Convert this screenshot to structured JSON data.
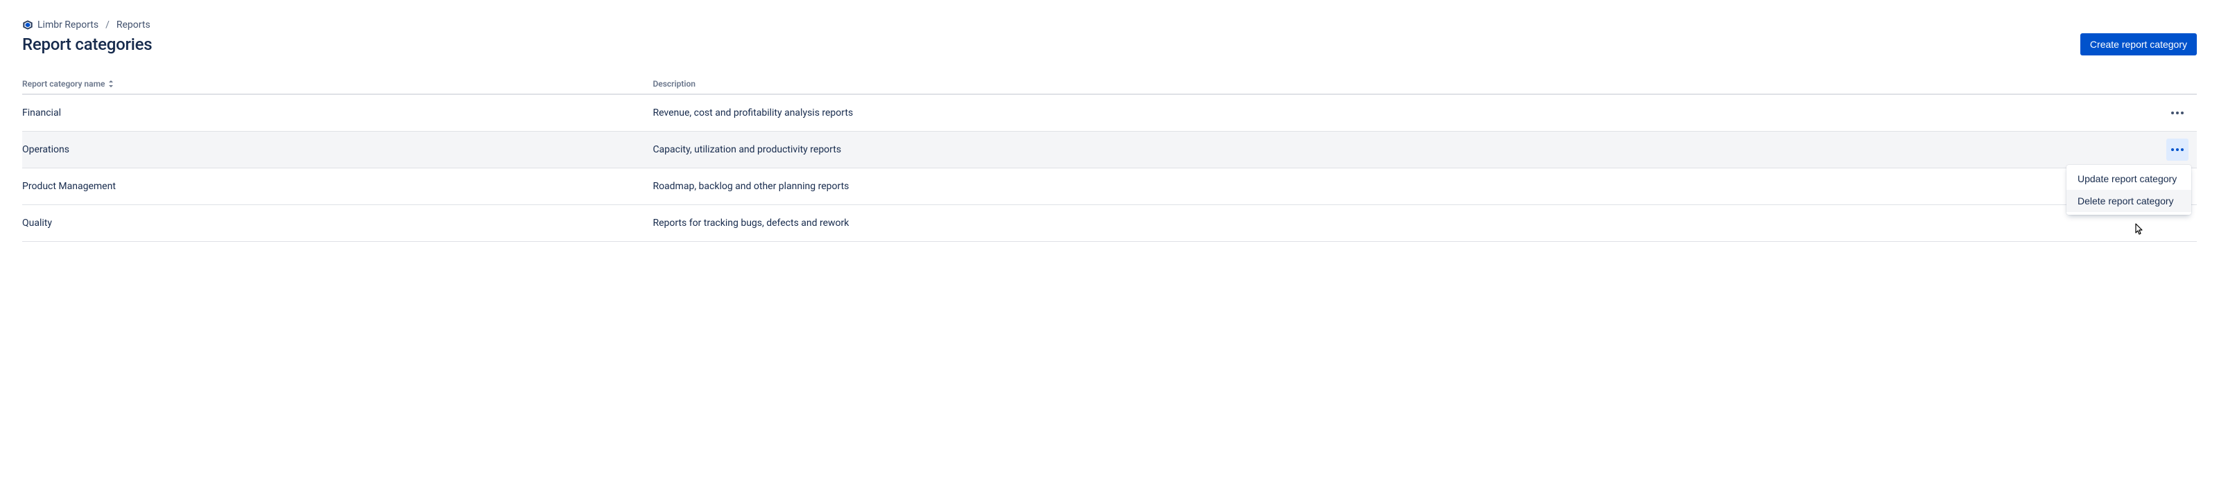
{
  "breadcrumb": {
    "app_name": "Limbr Reports",
    "section": "Reports"
  },
  "page": {
    "title": "Report categories",
    "create_button": "Create report category"
  },
  "table": {
    "columns": {
      "name": "Report category name",
      "description": "Description"
    },
    "rows": [
      {
        "name": "Financial",
        "description": "Revenue, cost and profitability analysis reports"
      },
      {
        "name": "Operations",
        "description": "Capacity, utilization and productivity reports"
      },
      {
        "name": "Product Management",
        "description": "Roadmap, backlog and other planning reports"
      },
      {
        "name": "Quality",
        "description": "Reports for tracking bugs, defects and rework"
      }
    ]
  },
  "menu": {
    "update": "Update report category",
    "delete": "Delete report category"
  }
}
